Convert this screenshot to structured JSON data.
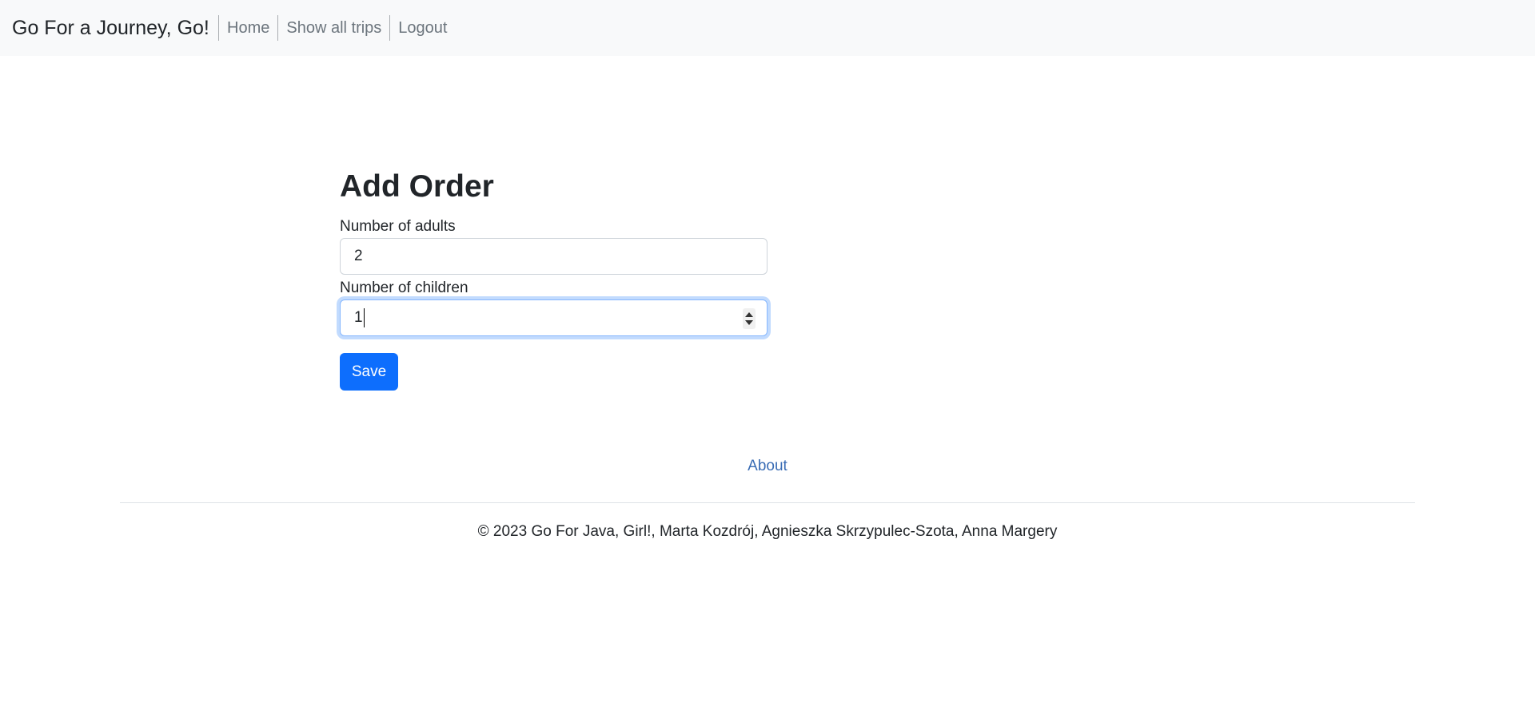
{
  "navbar": {
    "brand": "Go For a Journey, Go!",
    "links": [
      "Home",
      "Show all trips",
      "Logout"
    ]
  },
  "main": {
    "title": "Add Order",
    "adults_label": "Number of adults",
    "adults_value": "2",
    "children_label": "Number of children",
    "children_value": "1",
    "save_label": "Save"
  },
  "footer": {
    "about_label": "About",
    "copyright": "© 2023 Go For Java, Girl!, Marta Kozdrój, Agnieszka Skrzypulec-Szota, Anna Margery"
  },
  "colors": {
    "primary": "#0d6efd",
    "navbar_bg": "#f8f9fa",
    "link": "#3a6db5"
  }
}
